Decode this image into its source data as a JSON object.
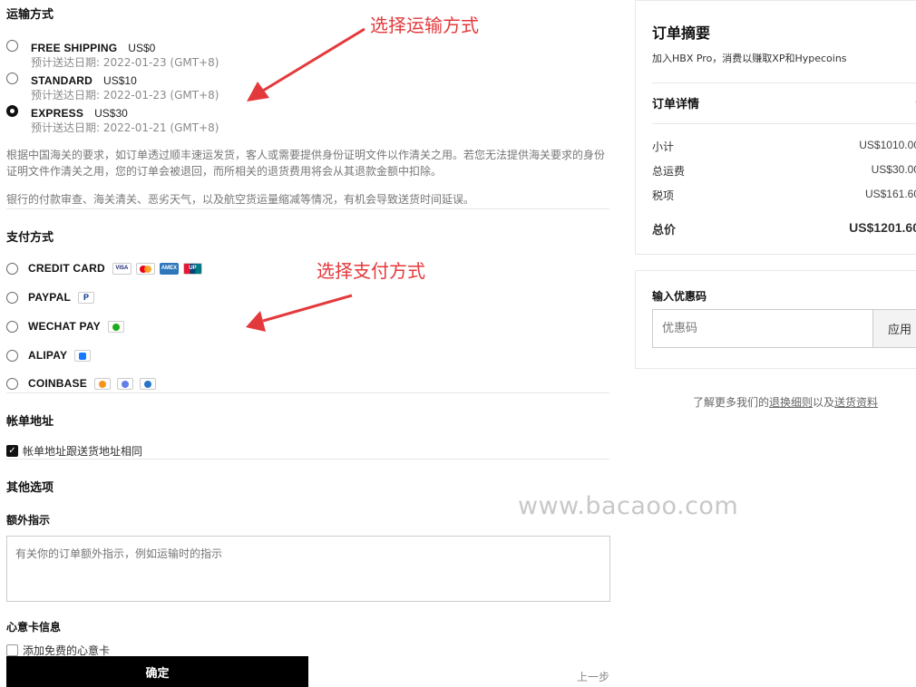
{
  "shipping": {
    "title": "运输方式",
    "options": [
      {
        "name": "FREE SHIPPING",
        "price": "US$0",
        "date": "预计送达日期: 2022-01-23 (GMT+8)",
        "selected": false
      },
      {
        "name": "STANDARD",
        "price": "US$10",
        "date": "预计送达日期: 2022-01-23 (GMT+8)",
        "selected": false
      },
      {
        "name": "EXPRESS",
        "price": "US$30",
        "date": "预计送达日期: 2022-01-21 (GMT+8)",
        "selected": true
      }
    ],
    "note1": "根据中国海关的要求，如订单透过顺丰速运发货，客人或需要提供身份证明文件以作清关之用。若您无法提供海关要求的身份证明文件作清关之用，您的订单会被退回，而所相关的退货费用将会从其退款金额中扣除。",
    "note2": "银行的付款审查、海关清关、恶劣天气，以及航空货运量缩减等情况，有机会导致送货时间延误。"
  },
  "payment": {
    "title": "支付方式",
    "options": [
      {
        "label": "CREDIT CARD"
      },
      {
        "label": "PAYPAL"
      },
      {
        "label": "WECHAT PAY"
      },
      {
        "label": "ALIPAY"
      },
      {
        "label": "COINBASE"
      }
    ],
    "card_icons": [
      "VISA",
      "",
      "AMEX",
      "UP"
    ]
  },
  "billing": {
    "title": "帐单地址",
    "same_label": "帐单地址跟送货地址相同"
  },
  "other": {
    "title": "其他选项",
    "extra_title": "额外指示",
    "extra_placeholder": "有关你的订单额外指示，例如运输时的指示",
    "gift_title": "心意卡信息",
    "gift_label": "添加免费的心意卡"
  },
  "actions": {
    "confirm": "确定",
    "back": "上一步"
  },
  "summary": {
    "title": "订单摘要",
    "subtitle": "加入HBX Pro，消费以赚取XP和Hypecoins",
    "details_label": "订单详情",
    "rows": [
      {
        "label": "小计",
        "value": "US$1010.00"
      },
      {
        "label": "总运费",
        "value": "US$30.00"
      },
      {
        "label": "税项",
        "value": "US$161.60"
      }
    ],
    "total_label": "总价",
    "total_value": "US$1201.60"
  },
  "promo": {
    "title": "输入优惠码",
    "placeholder": "优惠码",
    "apply": "应用"
  },
  "footer": {
    "pre": "了解更多我们的",
    "link1": "退换细则",
    "mid": "以及",
    "link2": "送货资料"
  },
  "annotations": {
    "shipping_note": "选择运输方式",
    "payment_note": "选择支付方式",
    "watermark": "www.bacaoo.com"
  },
  "colors": {
    "annotation": "#e4393c",
    "wechat": "#1aad19",
    "alipay": "#1677ff",
    "paypal": "#003087"
  }
}
